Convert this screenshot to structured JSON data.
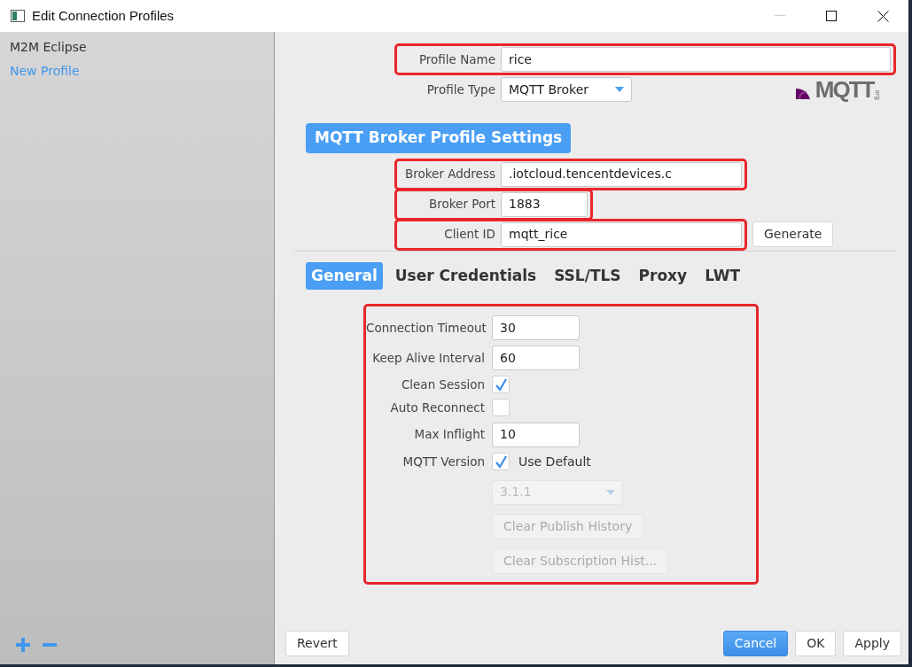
{
  "window": {
    "title": "Edit Connection Profiles"
  },
  "sidebar": {
    "items": [
      {
        "label": "M2M Eclipse",
        "selected": false
      },
      {
        "label": "New Profile",
        "selected": true
      }
    ]
  },
  "profile": {
    "fields": [
      {
        "kind": "text",
        "label": "Profile Name",
        "value": "rice",
        "highlighted": true
      },
      {
        "kind": "select",
        "label": "Profile Type",
        "value": "MQTT Broker",
        "highlighted": false
      }
    ]
  },
  "logo": {
    "text": "MQTT",
    "suffix": "org"
  },
  "section_title": "MQTT Broker Profile Settings",
  "broker": {
    "fields": [
      {
        "kind": "text",
        "label": "Broker Address",
        "value": ".iotcloud.tencentdevices.c",
        "highlighted": true
      },
      {
        "kind": "text",
        "label": "Broker Port",
        "value": "1883",
        "highlighted": true
      },
      {
        "kind": "text",
        "label": "Client ID",
        "value": "mqtt_rice",
        "highlighted": true,
        "button": "Generate"
      }
    ]
  },
  "tabs": [
    {
      "label": "General",
      "selected": true
    },
    {
      "label": "User Credentials",
      "selected": false
    },
    {
      "label": "SSL/TLS",
      "selected": false
    },
    {
      "label": "Proxy",
      "selected": false
    },
    {
      "label": "LWT",
      "selected": false
    }
  ],
  "general": {
    "highlighted": true,
    "rows": [
      {
        "kind": "text",
        "label": "Connection Timeout",
        "value": "30"
      },
      {
        "kind": "text",
        "label": "Keep Alive Interval",
        "value": "60"
      },
      {
        "kind": "checkbox",
        "label": "Clean Session",
        "checked": true
      },
      {
        "kind": "checkbox",
        "label": "Auto Reconnect",
        "checked": false
      },
      {
        "kind": "text",
        "label": "Max Inflight",
        "value": "10"
      },
      {
        "kind": "checkbox",
        "label": "MQTT Version",
        "checked": true,
        "text": "Use Default"
      },
      {
        "kind": "select",
        "value": "3.1.1",
        "disabled": true
      },
      {
        "kind": "button",
        "text": "Clear Publish History",
        "disabled": true
      },
      {
        "kind": "button",
        "text": "Clear Subscription Hist...",
        "disabled": true
      }
    ]
  },
  "buttons": [
    {
      "label": "Revert",
      "kind": "plain"
    },
    {
      "label": "Cancel",
      "kind": "primary"
    },
    {
      "label": "OK",
      "kind": "plain"
    },
    {
      "label": "Apply",
      "kind": "plain"
    }
  ]
}
